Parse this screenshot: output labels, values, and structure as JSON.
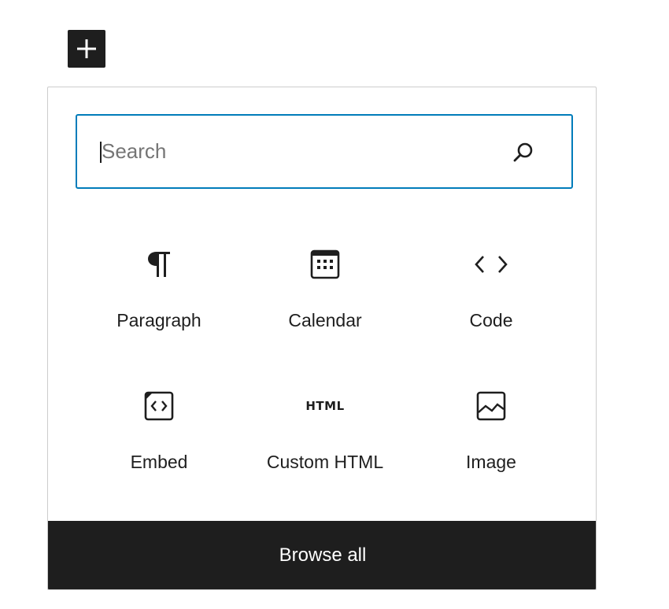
{
  "toggle": {
    "icon": "plus-icon"
  },
  "search": {
    "placeholder": "Search",
    "value": "",
    "icon": "search-icon",
    "focus_color": "#007cba"
  },
  "blocks": [
    {
      "label": "Paragraph",
      "icon": "paragraph-icon"
    },
    {
      "label": "Calendar",
      "icon": "calendar-icon"
    },
    {
      "label": "Code",
      "icon": "code-icon"
    },
    {
      "label": "Embed",
      "icon": "embed-icon"
    },
    {
      "label": "Custom HTML",
      "icon": "html-icon",
      "icon_text": "HTML"
    },
    {
      "label": "Image",
      "icon": "image-icon"
    }
  ],
  "footer": {
    "browse_all_label": "Browse all",
    "background": "#1e1e1e"
  }
}
